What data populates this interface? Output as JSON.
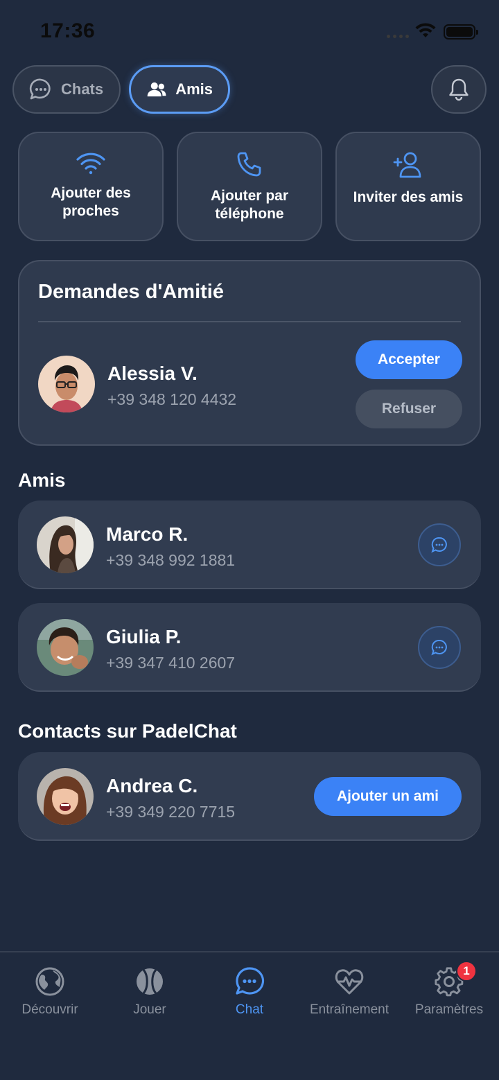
{
  "status_bar": {
    "time": "17:36"
  },
  "tabs": [
    {
      "label": "Chats",
      "icon": "chat-bubble-icon",
      "active": false
    },
    {
      "label": "Amis",
      "icon": "users-icon",
      "active": true
    }
  ],
  "quick_actions": [
    {
      "label": "Ajouter des proches",
      "icon": "wifi-icon"
    },
    {
      "label": "Ajouter par téléphone",
      "icon": "phone-icon"
    },
    {
      "label": "Inviter des amis",
      "icon": "add-user-icon"
    }
  ],
  "friend_requests": {
    "title": "Demandes d'Amitié",
    "items": [
      {
        "name": "Alessia V.",
        "phone": "+39 348 120 4432",
        "accept_label": "Accepter",
        "refuse_label": "Refuser"
      }
    ]
  },
  "friends": {
    "title": "Amis",
    "items": [
      {
        "name": "Marco R.",
        "phone": "+39 348 992 1881"
      },
      {
        "name": "Giulia P.",
        "phone": "+39 347 410 2607"
      }
    ]
  },
  "contacts": {
    "title": "Contacts sur PadelChat",
    "items": [
      {
        "name": "Andrea C.",
        "phone": "+39 349 220 7715",
        "add_label": "Ajouter un ami"
      }
    ]
  },
  "bottom_nav": [
    {
      "label": "Découvrir",
      "icon": "globe-icon",
      "active": false
    },
    {
      "label": "Jouer",
      "icon": "tennis-ball-icon",
      "active": false
    },
    {
      "label": "Chat",
      "icon": "chat-icon",
      "active": true
    },
    {
      "label": "Entraînement",
      "icon": "heart-pulse-icon",
      "active": false
    },
    {
      "label": "Paramètres",
      "icon": "gear-icon",
      "active": false,
      "badge": "1"
    }
  ],
  "colors": {
    "background": "#1f2a3e",
    "card": "#2f3a4e",
    "accent": "#3b82f6",
    "badge": "#ef3340"
  }
}
